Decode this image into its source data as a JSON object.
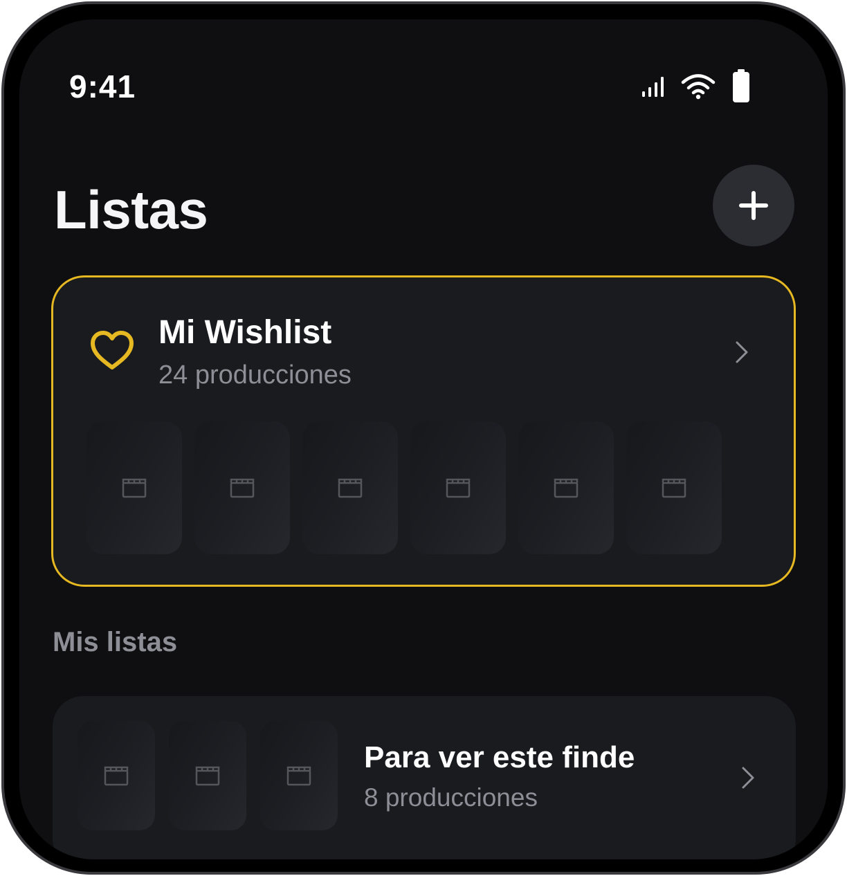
{
  "status_bar": {
    "time": "9:41",
    "icons": [
      "cellular-signal-icon",
      "wifi-icon",
      "battery-icon"
    ]
  },
  "header": {
    "title": "Listas",
    "add_icon": "plus-icon"
  },
  "wishlist": {
    "title": "Mi Wishlist",
    "subtitle": "24 producciones",
    "icon": "heart-icon",
    "accent_color": "#e6b821",
    "poster_count": 6
  },
  "my_lists": {
    "section_title": "Mis listas",
    "items": [
      {
        "title": "Para ver este finde",
        "subtitle": "8 producciones",
        "poster_count": 3
      }
    ]
  },
  "colors": {
    "background": "#0f0f11",
    "card": "#1a1b1f",
    "accent": "#e6b821",
    "secondary_text": "#8d8e96"
  }
}
